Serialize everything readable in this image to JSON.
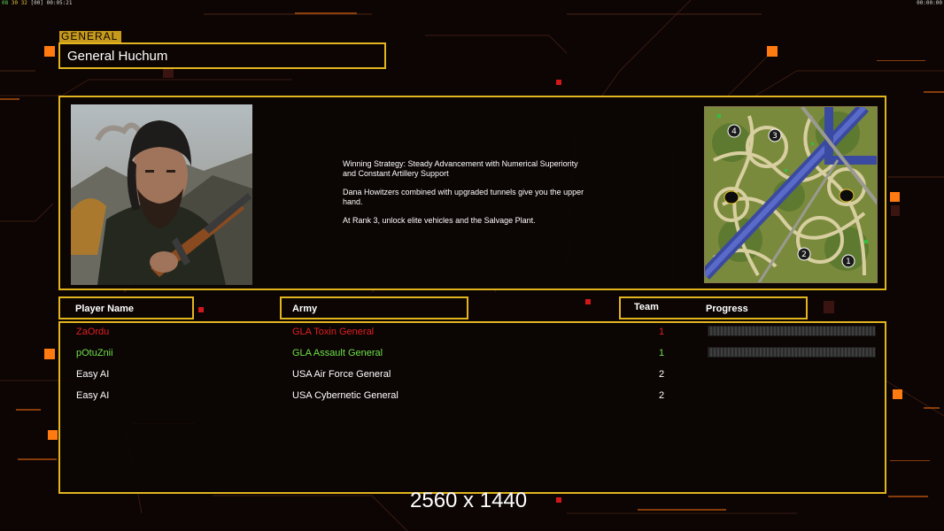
{
  "hud": {
    "left_green": "08",
    "left_numbers": "30 32",
    "left_dim": "[00]",
    "left_time": "00:05:21",
    "right_time": "00:00:00"
  },
  "general": {
    "tag": "GENERAL",
    "name": "General Huchum",
    "portrait_icon": "general-portrait",
    "description": [
      "Winning Strategy: Steady Advancement with Numerical Superiority\n and Constant Artillery Support",
      "Dana Howitzers combined with upgraded tunnels give you the upper\n hand.",
      "At Rank 3, unlock elite vehicles and the Salvage Plant."
    ]
  },
  "minimap": {
    "icon": "map-preview",
    "start_markers": [
      "4",
      "3",
      "2",
      "1"
    ]
  },
  "headers": {
    "player_name": "Player Name",
    "army": "Army",
    "team": "Team",
    "progress": "Progress"
  },
  "players": [
    {
      "name": "ZaOrdu",
      "army": "GLA Toxin General",
      "team": "1",
      "color": "#e02020",
      "has_progress": true
    },
    {
      "name": "pOtuZnii",
      "army": "GLA Assault General",
      "team": "1",
      "color": "#6ee04a",
      "has_progress": true
    },
    {
      "name": "Easy AI",
      "army": "USA Air Force General",
      "team": "2",
      "color": "#ffffff",
      "has_progress": false
    },
    {
      "name": "Easy AI",
      "army": "USA Cybernetic General",
      "team": "2",
      "color": "#ffffff",
      "has_progress": false
    }
  ],
  "resolution_label": "2560 x 1440",
  "colors": {
    "accent": "#e2b51f",
    "background": "#0c0504",
    "orange_light": "#ff7a10"
  }
}
